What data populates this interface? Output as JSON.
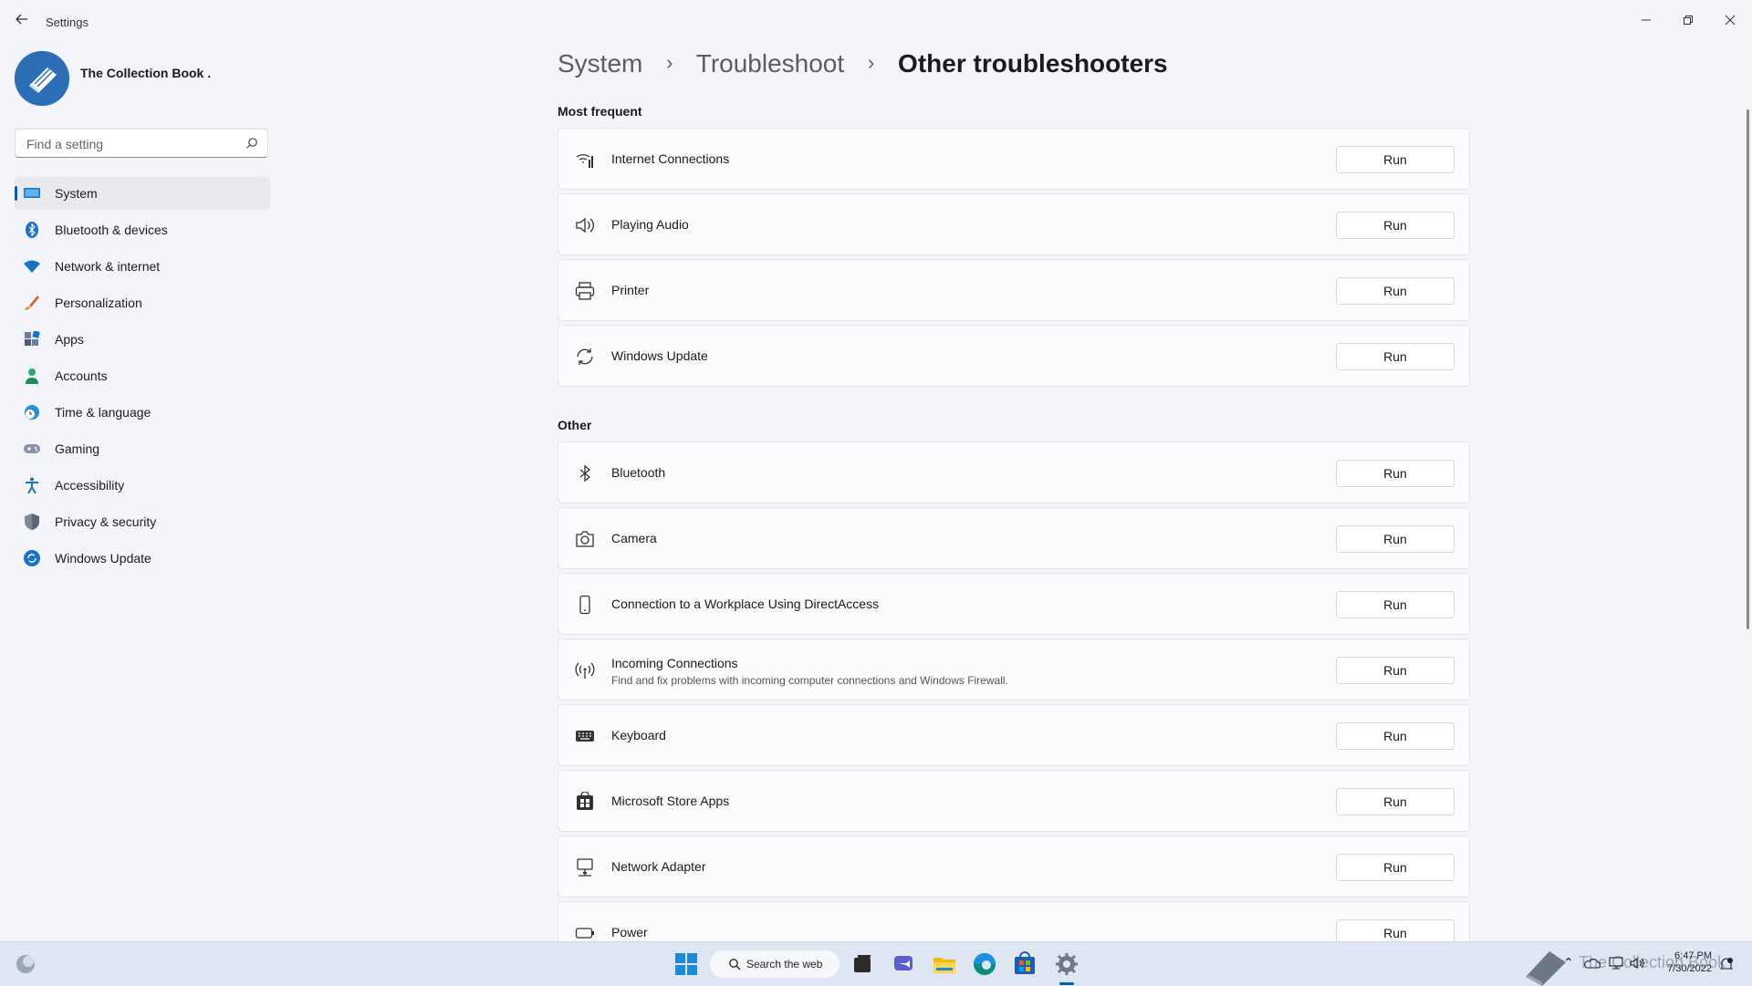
{
  "window": {
    "title": "Settings",
    "back_icon": "back-arrow-icon",
    "controls": [
      "minimize",
      "restore",
      "close"
    ]
  },
  "profile": {
    "name": "The Collection Book ."
  },
  "search": {
    "placeholder": "Find a setting"
  },
  "sidebar": {
    "active": "System",
    "items": [
      {
        "label": "System",
        "icon": "system-icon"
      },
      {
        "label": "Bluetooth & devices",
        "icon": "bluetooth-icon"
      },
      {
        "label": "Network & internet",
        "icon": "wifi-icon"
      },
      {
        "label": "Personalization",
        "icon": "brush-icon"
      },
      {
        "label": "Apps",
        "icon": "apps-icon"
      },
      {
        "label": "Accounts",
        "icon": "accounts-icon"
      },
      {
        "label": "Time & language",
        "icon": "globe-clock-icon"
      },
      {
        "label": "Gaming",
        "icon": "gamepad-icon"
      },
      {
        "label": "Accessibility",
        "icon": "accessibility-icon"
      },
      {
        "label": "Privacy & security",
        "icon": "shield-icon"
      },
      {
        "label": "Windows Update",
        "icon": "update-icon"
      }
    ]
  },
  "breadcrumb": {
    "system": "System",
    "troubleshoot": "Troubleshoot",
    "current": "Other troubleshooters"
  },
  "sections": {
    "most_frequent": {
      "label": "Most frequent",
      "items": [
        {
          "title": "Internet Connections",
          "icon": "wifi-signal-icon",
          "button": "Run"
        },
        {
          "title": "Playing Audio",
          "icon": "speaker-icon",
          "button": "Run"
        },
        {
          "title": "Printer",
          "icon": "printer-icon",
          "button": "Run"
        },
        {
          "title": "Windows Update",
          "icon": "sync-icon",
          "button": "Run"
        }
      ]
    },
    "other": {
      "label": "Other",
      "items": [
        {
          "title": "Bluetooth",
          "icon": "bluetooth-icon",
          "button": "Run"
        },
        {
          "title": "Camera",
          "icon": "camera-icon",
          "button": "Run"
        },
        {
          "title": "Connection to a Workplace Using DirectAccess",
          "icon": "phone-icon",
          "button": "Run"
        },
        {
          "title": "Incoming Connections",
          "desc": "Find and fix problems with incoming computer connections and Windows Firewall.",
          "icon": "antenna-icon",
          "button": "Run"
        },
        {
          "title": "Keyboard",
          "icon": "keyboard-icon",
          "button": "Run"
        },
        {
          "title": "Microsoft Store Apps",
          "icon": "store-icon",
          "button": "Run"
        },
        {
          "title": "Network Adapter",
          "icon": "network-adapter-icon",
          "button": "Run"
        },
        {
          "title": "Power",
          "icon": "battery-icon",
          "button": "Run"
        }
      ]
    }
  },
  "taskbar": {
    "search_label": "Search the web",
    "watermark": "The Collection Book",
    "time": "6:47 PM",
    "date": "7/30/2022"
  },
  "colors": {
    "accent": "#005fb8",
    "background": "#f3f5fb",
    "card": "#fbfbfd"
  }
}
